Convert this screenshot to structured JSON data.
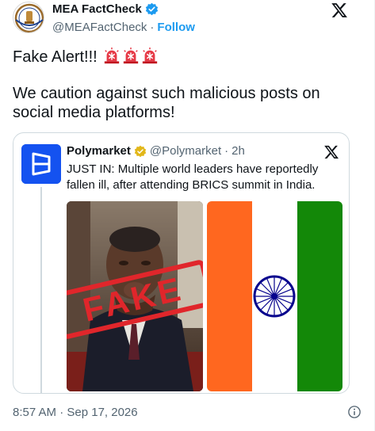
{
  "author": {
    "name": "MEA FactCheck",
    "handle": "@MEAFactCheck",
    "separator": "·",
    "follow_label": "Follow"
  },
  "post": {
    "line1": "Fake Alert!!!",
    "line2": "We caution against such malicious posts on social media platforms!"
  },
  "quoted": {
    "name": "Polymarket",
    "handle": "@Polymarket",
    "separator": "·",
    "time": "2h",
    "text": "JUST IN: Multiple world leaders have reportedly fallen ill, after attending BRICS summit in India.",
    "stamp": "FAKE"
  },
  "footer": {
    "timestamp": "8:57 AM · Sep 17, 2026"
  },
  "colors": {
    "accent": "#1d9bf0",
    "stamp_red": "#e0262b",
    "saffron": "#ff671f",
    "green": "#138808",
    "chakra": "#06038d"
  },
  "icons": [
    "verified-badge-icon",
    "x-logo-icon",
    "siren-icon",
    "gold-check-icon",
    "info-icon"
  ]
}
